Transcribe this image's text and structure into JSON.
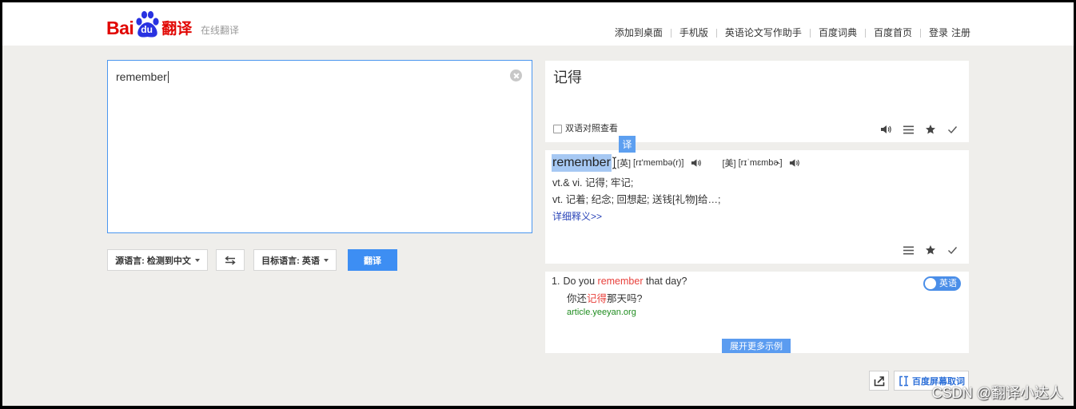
{
  "header": {
    "logo": {
      "bai": "Bai",
      "du": "du",
      "fanyi": "翻译"
    },
    "subtitle": "在线翻译",
    "links": [
      "添加到桌面",
      "手机版",
      "英语论文写作助手",
      "百度词典",
      "百度首页"
    ],
    "login": "登录",
    "register": "注册"
  },
  "source_panel": {
    "text": "remember",
    "clear_icon": "clear-icon"
  },
  "controls": {
    "source_language": "源语言: 检测到中文",
    "swap_icon": "swap-icon",
    "target_language": "目标语言: 英语",
    "dropdown_icon": "caret-down-icon",
    "translate_button": "翻译"
  },
  "translation_card": {
    "text": "记得",
    "bilingual_checkbox_label": "双语对照查看",
    "bilingual_checked": false,
    "tooltip": "译",
    "icons": [
      "speaker-icon",
      "list-icon",
      "star-icon",
      "check-icon"
    ]
  },
  "dictionary_card": {
    "word": "remember",
    "uk": {
      "label": "[英]",
      "phonetic": "[rɪ'membə(r)]"
    },
    "us": {
      "label": "[美]",
      "phonetic": "[rɪˈmɛmbɚ]"
    },
    "definitions": [
      "vt.& vi. 记得; 牢记;",
      "vt. 记着; 纪念; 回想起; 送钱[礼物]给…;"
    ],
    "detail_link": "详细释义>>",
    "icons": [
      "list-icon",
      "star-icon",
      "check-icon"
    ]
  },
  "examples_card": {
    "toggle_label": "英语",
    "items": [
      {
        "index": "1.",
        "en_before": "Do you ",
        "en_highlight": "remember",
        "en_after": " that day?",
        "zh_before": "你还",
        "zh_highlight": "记得",
        "zh_after": "那天吗?",
        "source": "article.yeeyan.org"
      }
    ],
    "more_button": "展开更多示例"
  },
  "bottom_tools": {
    "share_icon": "share-icon",
    "screen_word_icon": "screen-word-icon",
    "screen_word_label": "百度屏幕取词"
  },
  "watermark": "CSDN @翻译小达人",
  "colors": {
    "accent": "#3d8ef3",
    "brand_red": "#e10602",
    "brand_blue": "#2932e1",
    "highlight_red": "#e8413c",
    "source_green": "#1f8c1f",
    "link_blue": "#2a44b8"
  }
}
